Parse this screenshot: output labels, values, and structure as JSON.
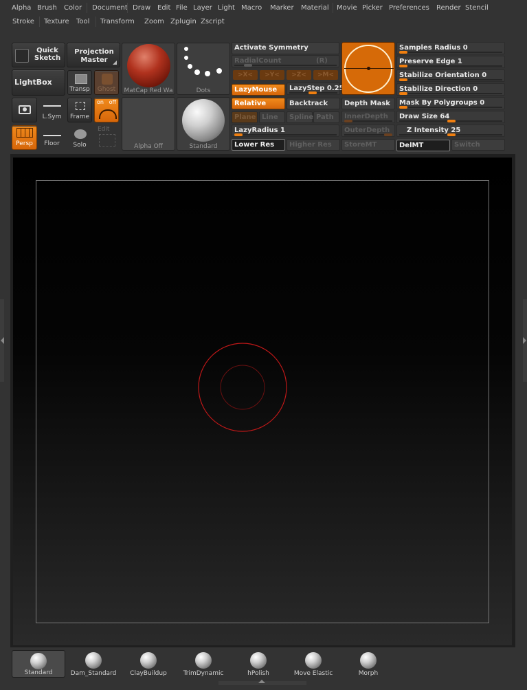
{
  "menus": {
    "row1": [
      "Alpha",
      "Brush",
      "Color",
      "Document",
      "Draw",
      "Edit",
      "File",
      "Layer",
      "Light",
      "Macro",
      "Marker",
      "Material",
      "Movie",
      "Picker",
      "Preferences",
      "Render",
      "Stencil"
    ],
    "row2": [
      "Stroke",
      "Texture",
      "Tool",
      "Transform",
      "Zoom",
      "Zplugin",
      "Zscript"
    ]
  },
  "shelf": {
    "quick_sketch": "Quick\nSketch",
    "projection_master": "Projection\nMaster",
    "lightbox": "LightBox",
    "transp": "Transp",
    "ghost": "Ghost",
    "lsym": "L.Sym",
    "frame": "Frame",
    "persp": "Persp",
    "floor": "Floor",
    "solo": "Solo",
    "edit": "Edit",
    "onoff_on": "on",
    "onoff_off": "off",
    "material_label": "MatCap Red Wa",
    "stroke_label": "Dots",
    "alpha_label": "Alpha Off",
    "brush_label": "Standard"
  },
  "symmetry": {
    "activate": "Activate Symmetry",
    "radialcount": "RadialCount",
    "r": "(R)",
    "axes": [
      ">X<",
      ">Y<",
      ">Z<",
      ">M<"
    ],
    "lazymouse": "LazyMouse",
    "lazystep": "LazyStep 0.25",
    "relative": "Relative",
    "backtrack": "Backtrack",
    "plane": "Plane",
    "line": "Line",
    "spline": "Spline",
    "path": "Path",
    "lazyradius": "LazyRadius 1",
    "lower_res": "Lower Res",
    "higher_res": "Higher Res"
  },
  "depth": {
    "depth_mask": "Depth Mask",
    "inner_depth": "InnerDepth",
    "outer_depth": "OuterDepth",
    "storemt": "StoreMT",
    "delmt": "DelMT",
    "switch": "Switch"
  },
  "right_sliders": {
    "samples_radius": "Samples Radius 0",
    "preserve_edge": "Preserve Edge 1",
    "stabilize_orientation": "Stabilize Orientation 0",
    "stabilize_direction": "Stabilize Direction 0",
    "mask_by_polygroups": "Mask By Polygroups 0",
    "draw_size": "Draw Size 64",
    "z_intensity": "Z Intensity 25"
  },
  "brushes": [
    "Standard",
    "Dam_Standard",
    "ClayBuildup",
    "TrimDynamic",
    "hPolish",
    "Move Elastic",
    "Morph"
  ],
  "colors": {
    "accent": "#f07f10",
    "cursor_red": "#c01818"
  }
}
